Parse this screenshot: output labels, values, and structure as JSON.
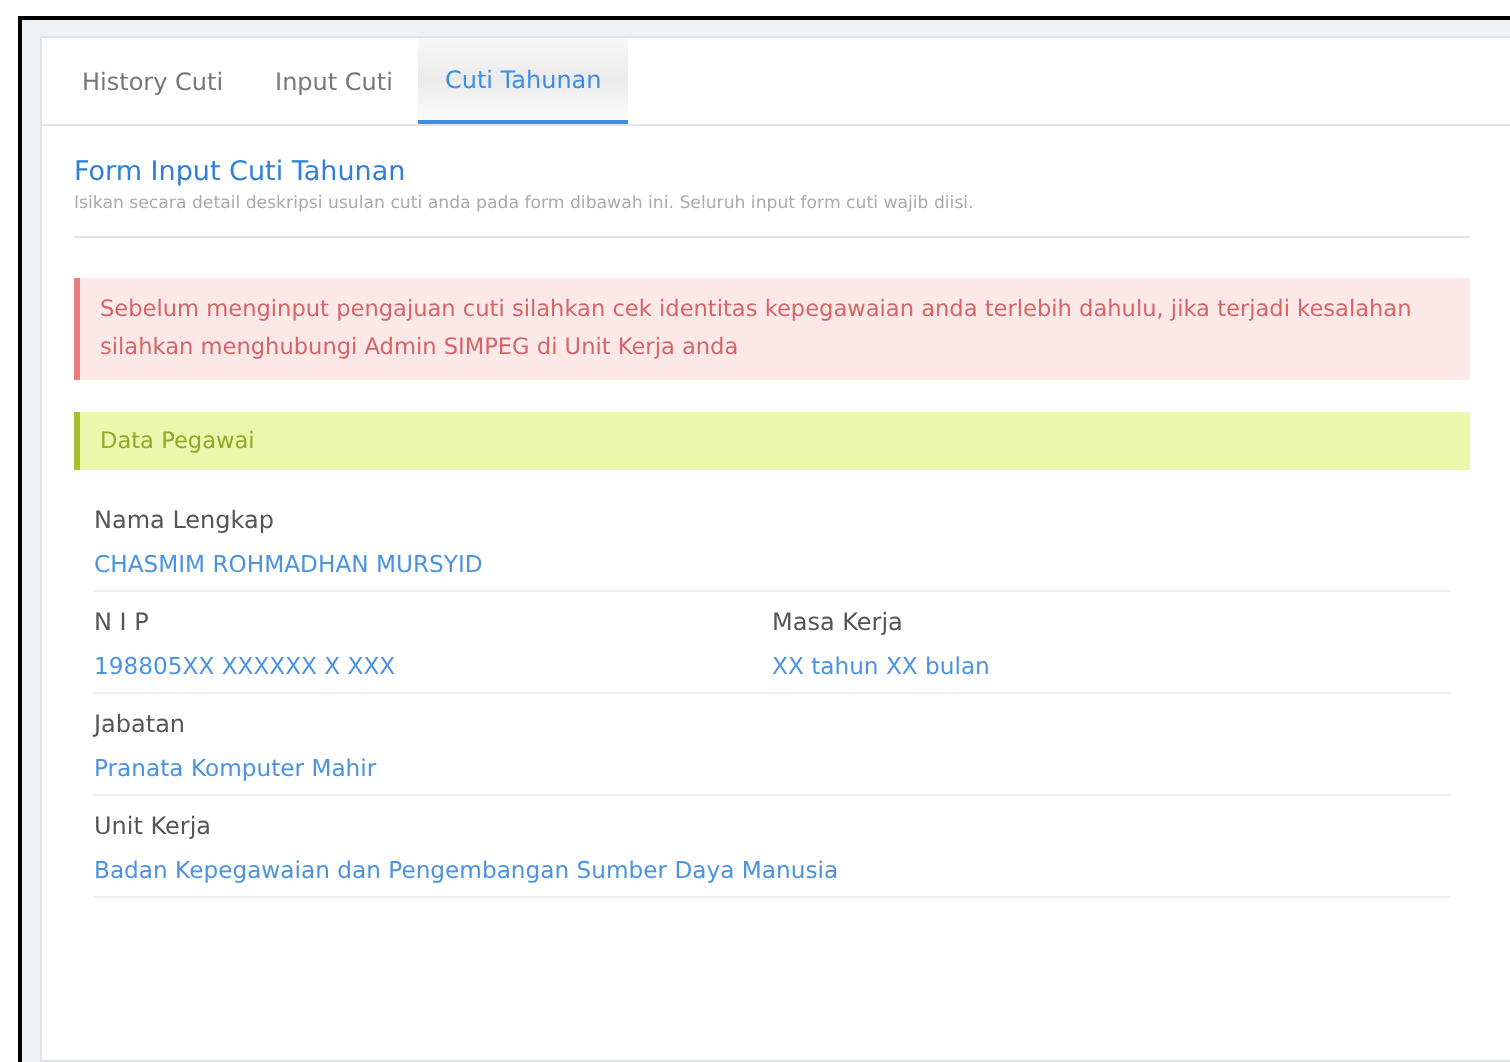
{
  "tabs": [
    {
      "label": "History Cuti",
      "selected": false
    },
    {
      "label": "Input Cuti",
      "selected": false
    },
    {
      "label": "Cuti Tahunan",
      "selected": true
    }
  ],
  "form": {
    "title": "Form Input Cuti Tahunan",
    "subtitle": "Isikan secara detail deskripsi usulan cuti anda pada form dibawah ini. Seluruh input form cuti wajib diisi."
  },
  "alert": "Sebelum menginput pengajuan cuti silahkan cek identitas kepegawaian anda terlebih dahulu, jika terjadi kesalahan silahkan menghubungi Admin SIMPEG di Unit Kerja anda",
  "section": "Data Pegawai",
  "rows": [
    {
      "fields": [
        {
          "label": "Nama Lengkap",
          "value": "CHASMIM ROHMADHAN MURSYID"
        }
      ]
    },
    {
      "fields": [
        {
          "label": "N I P",
          "value": "198805XX XXXXXX X XXX"
        },
        {
          "label": "Masa Kerja",
          "value": "XX tahun XX bulan"
        }
      ]
    },
    {
      "fields": [
        {
          "label": "Jabatan",
          "value": "Pranata Komputer Mahir"
        }
      ]
    },
    {
      "fields": [
        {
          "label": "Unit Kerja",
          "value": "Badan Kepegawaian dan Pengembangan Sumber Daya Manusia"
        }
      ]
    }
  ]
}
